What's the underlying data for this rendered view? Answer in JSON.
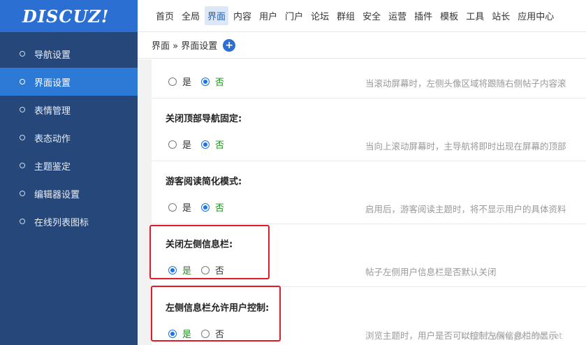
{
  "logo": "DISCUZ!",
  "topnav": [
    "首页",
    "全局",
    "界面",
    "内容",
    "用户",
    "门户",
    "论坛",
    "群组",
    "安全",
    "运营",
    "插件",
    "模板",
    "工具",
    "站长",
    "应用中心"
  ],
  "topnav_active_index": 2,
  "sidebar": {
    "items": [
      {
        "label": "导航设置",
        "active": false
      },
      {
        "label": "界面设置",
        "active": true
      },
      {
        "label": "表情管理",
        "active": false
      },
      {
        "label": "表态动作",
        "active": false
      },
      {
        "label": "主题鉴定",
        "active": false
      },
      {
        "label": "编辑器设置",
        "active": false
      },
      {
        "label": "在线列表图标",
        "active": false
      }
    ]
  },
  "breadcrumb": {
    "text": "界面 » 界面设置",
    "add_icon": "plus-circle-icon"
  },
  "settings": [
    {
      "title": "",
      "yes": "是",
      "no": "否",
      "value": "no",
      "hint": "当滚动屏幕时，左侧头像区域将跟随右侧帖子内容滚"
    },
    {
      "title": "关闭顶部导航固定:",
      "yes": "是",
      "no": "否",
      "value": "no",
      "hint": "当向上滚动屏幕时，主导航将即时出现在屏幕的顶部"
    },
    {
      "title": "游客阅读简化模式:",
      "yes": "是",
      "no": "否",
      "value": "no",
      "hint": "启用后，游客阅读主题时，将不显示用户的具体资料"
    },
    {
      "title": "关闭左侧信息栏:",
      "yes": "是",
      "no": "否",
      "value": "yes",
      "hint": "帖子左侧用户信息栏是否默认关闭"
    },
    {
      "title": "左侧信息栏允许用户控制:",
      "yes": "是",
      "no": "否",
      "value": "yes",
      "hint": "浏览主题时，用户是否可以控制左侧信息栏的显示"
    }
  ],
  "watermark": "https://www.yixuanz.net",
  "colors": {
    "brand": "#2a6fd1",
    "sidebar": "#26477a",
    "highlight": "#e0192b"
  }
}
